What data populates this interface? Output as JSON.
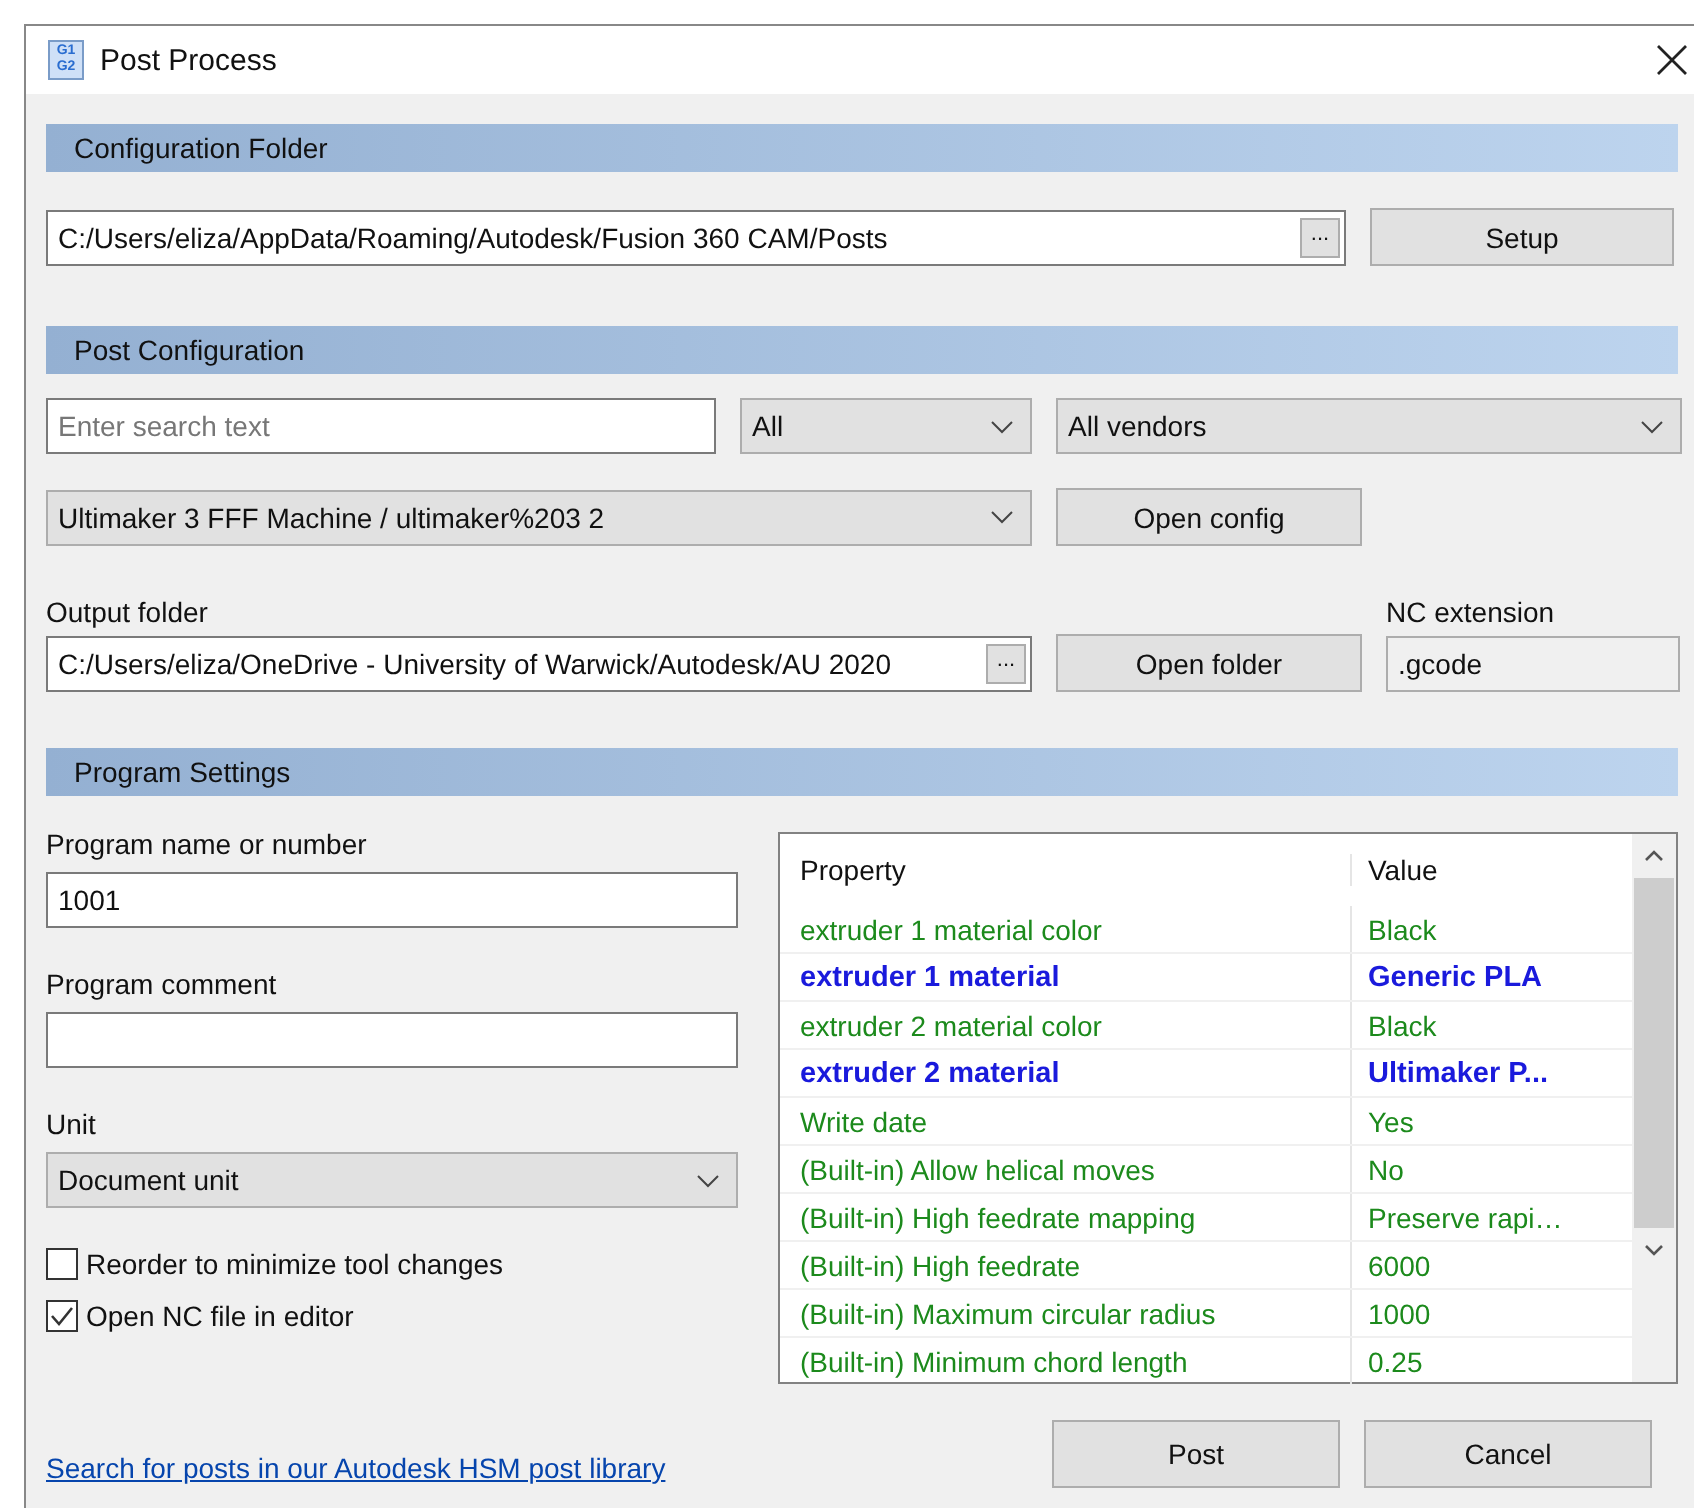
{
  "window": {
    "title": "Post Process",
    "icon_text": "G1\nG2"
  },
  "configuration_folder": {
    "heading": "Configuration Folder",
    "path": "C:/Users/eliza/AppData/Roaming/Autodesk/Fusion 360 CAM/Posts",
    "browse": "...",
    "setup_button": "Setup"
  },
  "post_configuration": {
    "heading": "Post Configuration",
    "search": {
      "placeholder": "Enter search text"
    },
    "filter": "All",
    "vendor": "All vendors",
    "machine": "Ultimaker 3 FFF Machine / ultimaker%203 2",
    "open_config_button": "Open config",
    "output_folder_label": "Output folder",
    "output_folder": "C:/Users/eliza/OneDrive - University of Warwick/Autodesk/AU 2020",
    "browse": "...",
    "open_folder_button": "Open folder",
    "nc_extension_label": "NC extension",
    "nc_extension": ".gcode"
  },
  "program_settings": {
    "heading": "Program Settings",
    "name_label": "Program name or number",
    "name_value": "1001",
    "comment_label": "Program comment",
    "unit_label": "Unit",
    "unit": "Document unit",
    "checkboxes": [
      {
        "label": "Reorder to minimize tool changes",
        "checked": false
      },
      {
        "label": "Open NC file in editor",
        "checked": true
      }
    ],
    "table": {
      "columns": [
        "Property",
        "Value"
      ],
      "rows": [
        {
          "property": "extruder 1 material color",
          "value": "Black",
          "highlighted": false
        },
        {
          "property": "extruder 1 material",
          "value": "Generic PLA",
          "highlighted": true
        },
        {
          "property": "extruder 2 material color",
          "value": "Black",
          "highlighted": false
        },
        {
          "property": "extruder 2 material",
          "value": "Ultimaker P...",
          "highlighted": true
        },
        {
          "property": "Write date",
          "value": "Yes",
          "highlighted": false
        },
        {
          "property": "(Built-in) Allow helical moves",
          "value": "No",
          "highlighted": false
        },
        {
          "property": "(Built-in) High feedrate mapping",
          "value": "Preserve rapi…",
          "highlighted": false
        },
        {
          "property": "(Built-in) High feedrate",
          "value": "6000",
          "highlighted": false
        },
        {
          "property": "(Built-in) Maximum circular radius",
          "value": "1000",
          "highlighted": false
        },
        {
          "property": "(Built-in) Minimum chord length",
          "value": "0.25",
          "highlighted": false
        }
      ]
    }
  },
  "footer": {
    "link": "Search for posts in our Autodesk HSM post library",
    "buttons": [
      "Post",
      "Cancel"
    ]
  }
}
